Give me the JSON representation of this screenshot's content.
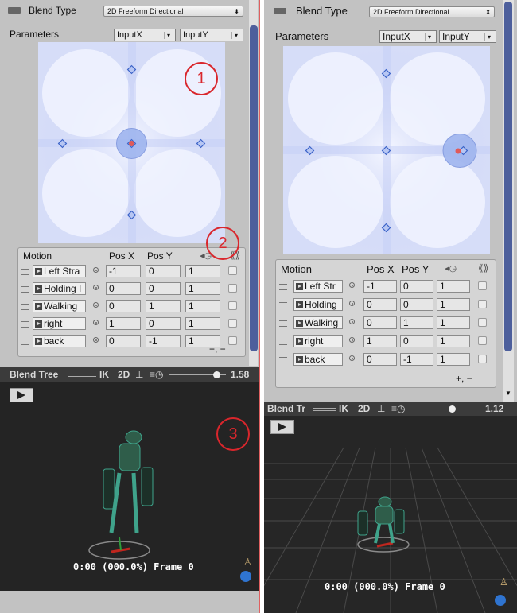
{
  "colors": {
    "accent": "#4d5f9c",
    "annotation": "#d9262c",
    "selected_point": "#e05a5a"
  },
  "left": {
    "blend_type_label": "Blend Type",
    "blend_type_value": "2D Freeform Directional",
    "parameters_label": "Parameters",
    "param_x": "InputX",
    "param_y": "InputY",
    "motion_header": {
      "motion": "Motion",
      "pos_x": "Pos X",
      "pos_y": "Pos Y"
    },
    "motions": [
      {
        "clip": "Left Stra",
        "x": "-1",
        "y": "0",
        "speed": "1"
      },
      {
        "clip": "Holding I",
        "x": "0",
        "y": "0",
        "speed": "1"
      },
      {
        "clip": "Walking",
        "x": "0",
        "y": "1",
        "speed": "1"
      },
      {
        "clip": "right",
        "x": "1",
        "y": "0",
        "speed": "1"
      },
      {
        "clip": "back",
        "x": "0",
        "y": "-1",
        "speed": "1"
      }
    ],
    "add_remove": "+, −",
    "tree_bar": {
      "title": "Blend Tree",
      "ik": "IK",
      "two_d": "2D",
      "speed": "1.58"
    },
    "frame": "0:00 (000.0%) Frame 0",
    "annotations": [
      "1",
      "2",
      "3"
    ]
  },
  "right": {
    "blend_type_label": "Blend Type",
    "blend_type_value": "2D Freeform Directional",
    "parameters_label": "Parameters",
    "param_x": "InputX",
    "param_y": "InputY",
    "motion_header": {
      "motion": "Motion",
      "pos_x": "Pos X",
      "pos_y": "Pos Y"
    },
    "motions": [
      {
        "clip": "Left Str",
        "x": "-1",
        "y": "0",
        "speed": "1"
      },
      {
        "clip": "Holding",
        "x": "0",
        "y": "0",
        "speed": "1"
      },
      {
        "clip": "Walking",
        "x": "0",
        "y": "1",
        "speed": "1"
      },
      {
        "clip": "right",
        "x": "1",
        "y": "0",
        "speed": "1"
      },
      {
        "clip": "back",
        "x": "0",
        "y": "-1",
        "speed": "1"
      }
    ],
    "add_remove": "+, −",
    "tree_bar": {
      "title": "Blend Tr",
      "ik": "IK",
      "two_d": "2D",
      "speed": "1.12"
    },
    "frame": "0:00 (000.0%) Frame 0"
  }
}
